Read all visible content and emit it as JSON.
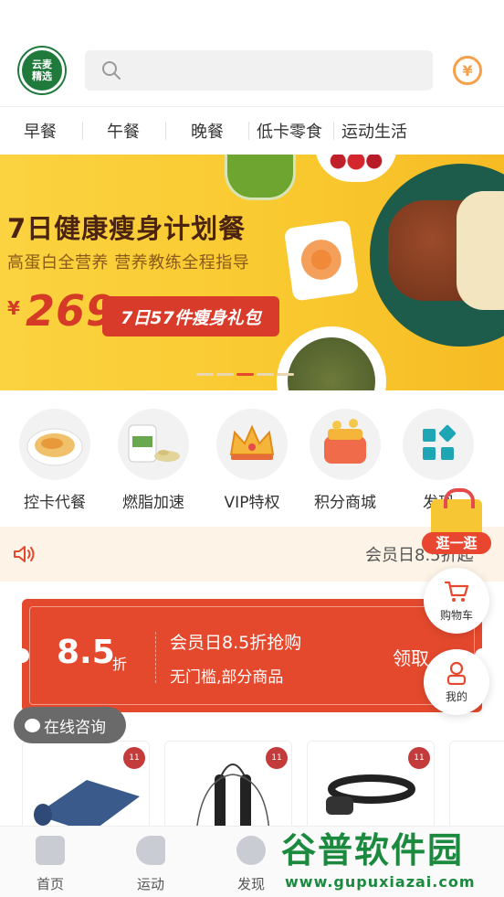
{
  "header": {
    "logo_line1": "云麦",
    "logo_line2": "精选",
    "search_placeholder": "",
    "coin_symbol": "¥"
  },
  "meal_tabs": [
    "早餐",
    "午餐",
    "晚餐",
    "低卡零食",
    "运动生活"
  ],
  "banner": {
    "title": "7日健康瘦身计划餐",
    "subtitle": "高蛋白全营养 营养教练全程指导",
    "price_symbol": "¥",
    "price": "269",
    "package": "7日57件瘦身礼包",
    "slides": 5,
    "active_slide": 3
  },
  "categories": [
    {
      "label": "控卡代餐",
      "icon": "meal-plate-icon"
    },
    {
      "label": "燃脂加速",
      "icon": "supplement-bottle-icon"
    },
    {
      "label": "VIP特权",
      "icon": "crown-icon"
    },
    {
      "label": "积分商城",
      "icon": "gift-box-icon"
    },
    {
      "label": "发现",
      "icon": "apps-grid-icon"
    }
  ],
  "notice": {
    "icon": "speaker-icon",
    "text": "会员日8.5折起"
  },
  "coupon": {
    "amount": "8.5",
    "unit": "折",
    "title": "会员日8.5折抢购",
    "desc": "无门槛,部分商品",
    "action": "领取"
  },
  "floating": {
    "consult": "在线咨询",
    "shop_label": "逛一逛",
    "cart_label": "购物车",
    "mine_label": "我的"
  },
  "products": [
    {
      "name": "yoga-mat",
      "tag": "11"
    },
    {
      "name": "jump-rope",
      "tag": "11"
    },
    {
      "name": "resistance-band",
      "tag": "11"
    }
  ],
  "bottom_nav": [
    {
      "label": "首页",
      "icon": "home-icon"
    },
    {
      "label": "运动",
      "icon": "shoe-icon"
    },
    {
      "label": "发现",
      "icon": "compass-icon"
    }
  ],
  "watermark": {
    "line1": "谷普软件园",
    "line2": "www.gupuxiazai.com"
  },
  "colors": {
    "accent_red": "#e5492d",
    "banner_yellow": "#fbd340",
    "brand_green": "#1f7a3c",
    "coin_orange": "#f7a04a"
  }
}
